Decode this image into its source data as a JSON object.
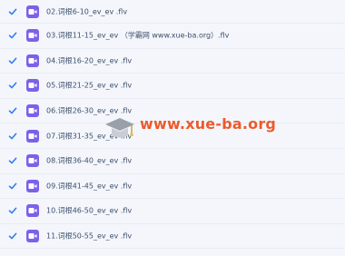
{
  "files": [
    {
      "name": "02.词根6-10_ev_ev .flv",
      "checked": true
    },
    {
      "name": "03.词根11-15_ev_ev （学霸网 www.xue-ba.org）.flv",
      "checked": true
    },
    {
      "name": "04.词根16-20_ev_ev .flv",
      "checked": true
    },
    {
      "name": "05.词根21-25_ev_ev .flv",
      "checked": true
    },
    {
      "name": "06.词根26-30_ev_ev .flv",
      "checked": true
    },
    {
      "name": "07.词根31-35_ev_ev .flv",
      "checked": true
    },
    {
      "name": "08.词根36-40_ev_ev .flv",
      "checked": true
    },
    {
      "name": "09.词根41-45_ev_ev .flv",
      "checked": true
    },
    {
      "name": "10.词根46-50_ev_ev .flv",
      "checked": true
    },
    {
      "name": "11.词根50-55_ev_ev .flv",
      "checked": true
    }
  ],
  "watermark": {
    "text": "www.xue-ba.org"
  },
  "colors": {
    "checkmark": "#2f7cf6",
    "file_icon": "#7c61e8",
    "file_name": "#3c4f6c",
    "watermark": "#ec5a2c",
    "background": "#f4f6fb"
  },
  "icons": {
    "check": "check-icon",
    "file": "video-file-icon",
    "watermark": "graduation-cap-icon"
  }
}
